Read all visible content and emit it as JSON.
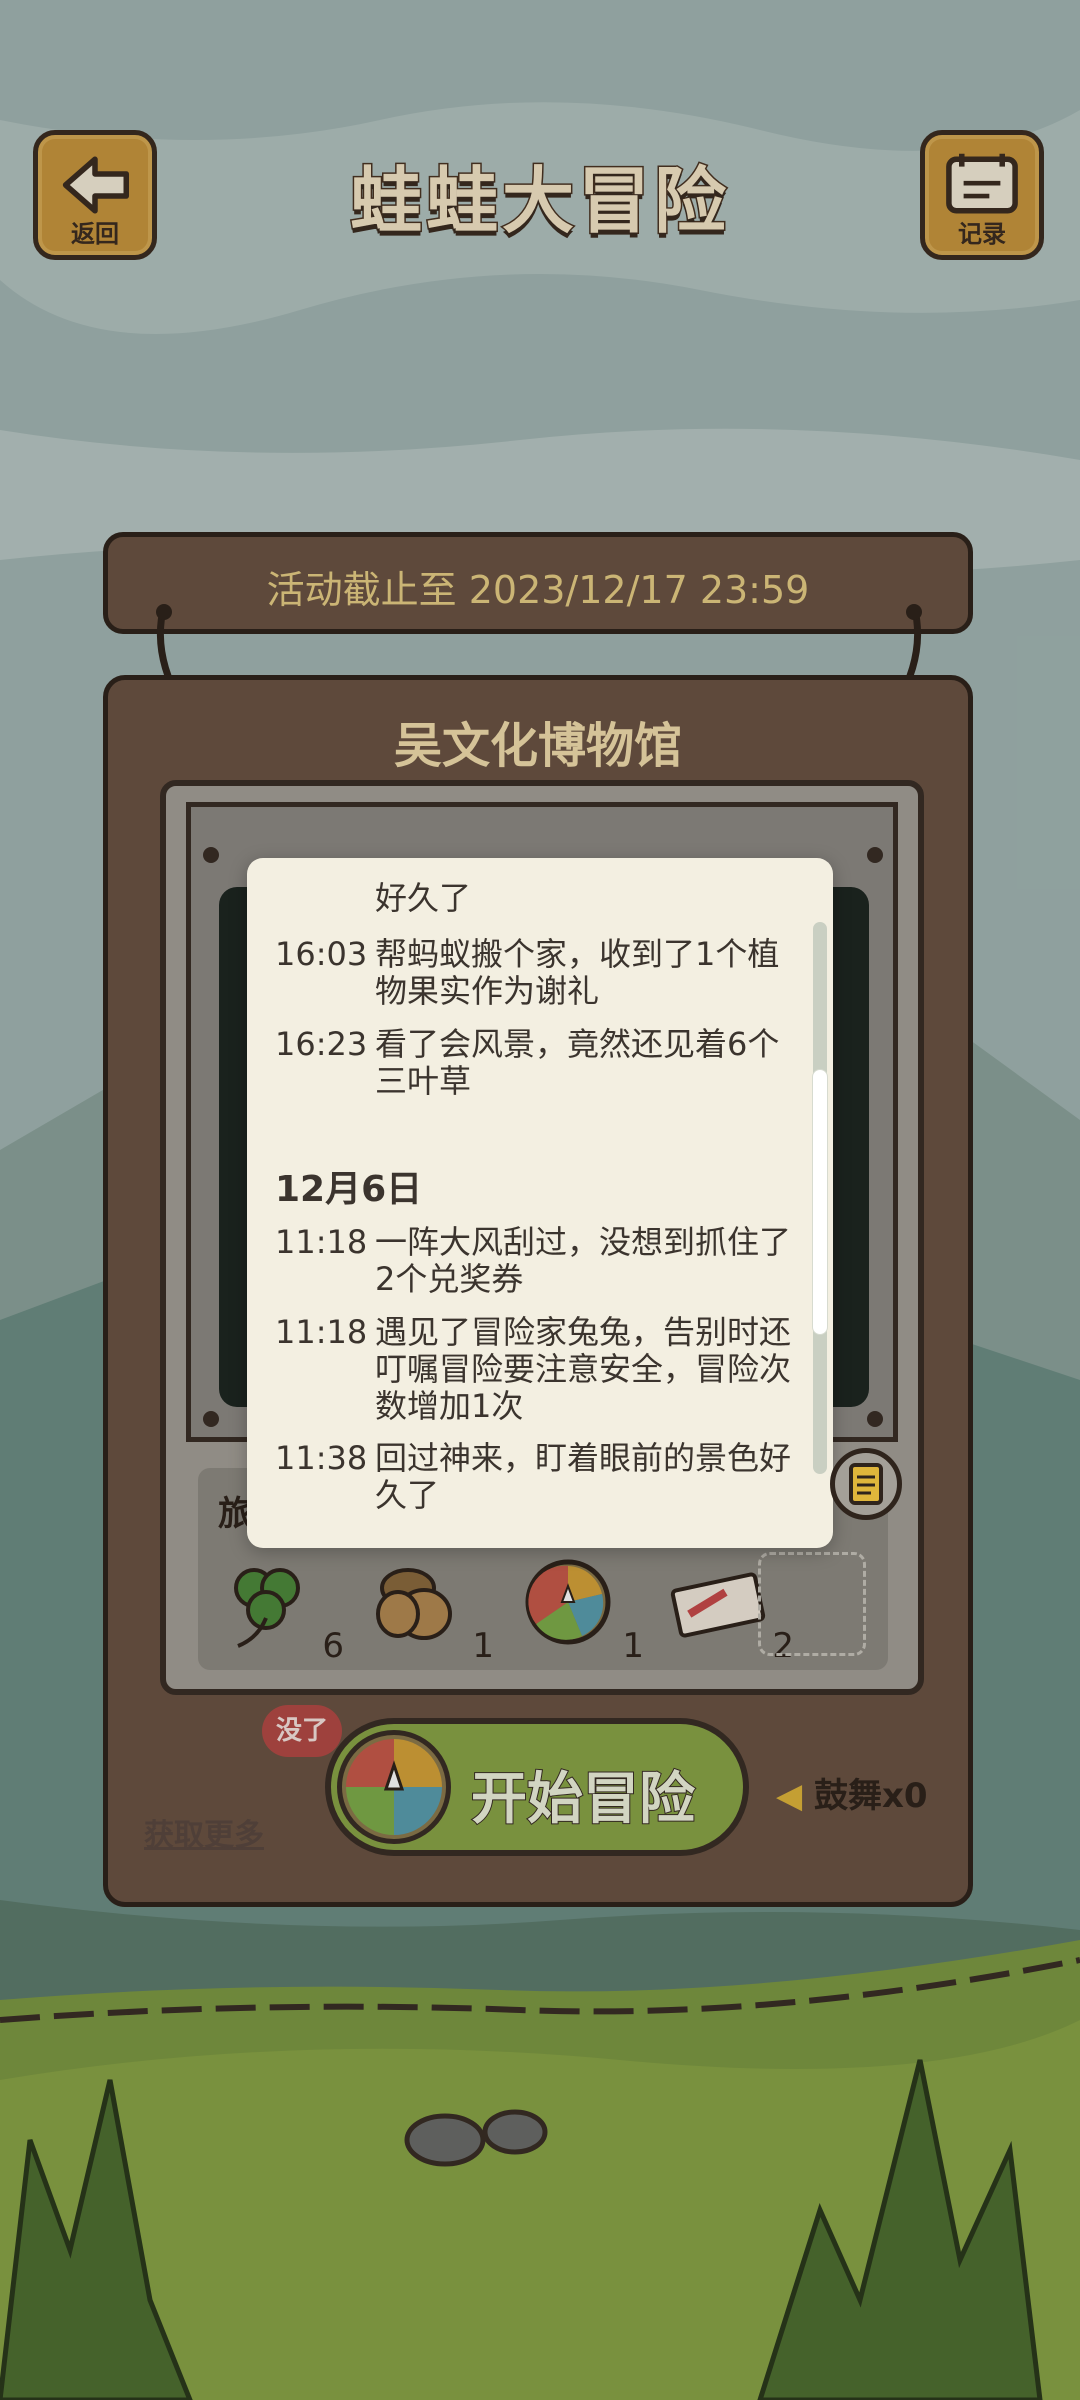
{
  "header": {
    "back_label": "返回",
    "title": "蛙蛙大冒险",
    "record_label": "记录"
  },
  "deadline": "活动截止至 2023/12/17 23:59",
  "museum_title": "吴文化博物馆",
  "items": {
    "section_label": "旅",
    "list": [
      {
        "icon": "clover-icon",
        "count": "6"
      },
      {
        "icon": "acorn-icon",
        "count": "1"
      },
      {
        "icon": "lucky-wheel-icon",
        "count": "1"
      },
      {
        "icon": "ticket-icon",
        "count": "2"
      }
    ]
  },
  "start": {
    "badge": "没了",
    "label": "开始冒险",
    "get_more": "获取更多",
    "cheer": "鼓舞x0"
  },
  "log": {
    "entries_before": [
      {
        "time": "",
        "text": "好久了"
      },
      {
        "time": "16:03",
        "text": "帮蚂蚁搬个家，收到了1个植物果实作为谢礼"
      },
      {
        "time": "16:23",
        "text": "看了会风景，竟然还见着6个三叶草"
      }
    ],
    "date_heading": "12月6日",
    "entries_after": [
      {
        "time": "11:18",
        "text": "一阵大风刮过，没想到抓住了2个兑奖券"
      },
      {
        "time": "11:18",
        "text": "遇见了冒险家兔兔，告别时还叮嘱冒险要注意安全，冒险次数增加1次"
      },
      {
        "time": "11:38",
        "text": "回过神来，盯着眼前的景色好久了"
      }
    ]
  },
  "colors": {
    "wood": "#6b5444",
    "button_wood": "#c9973e",
    "grass": "#8aa547",
    "popup_bg": "#f3efe1"
  }
}
